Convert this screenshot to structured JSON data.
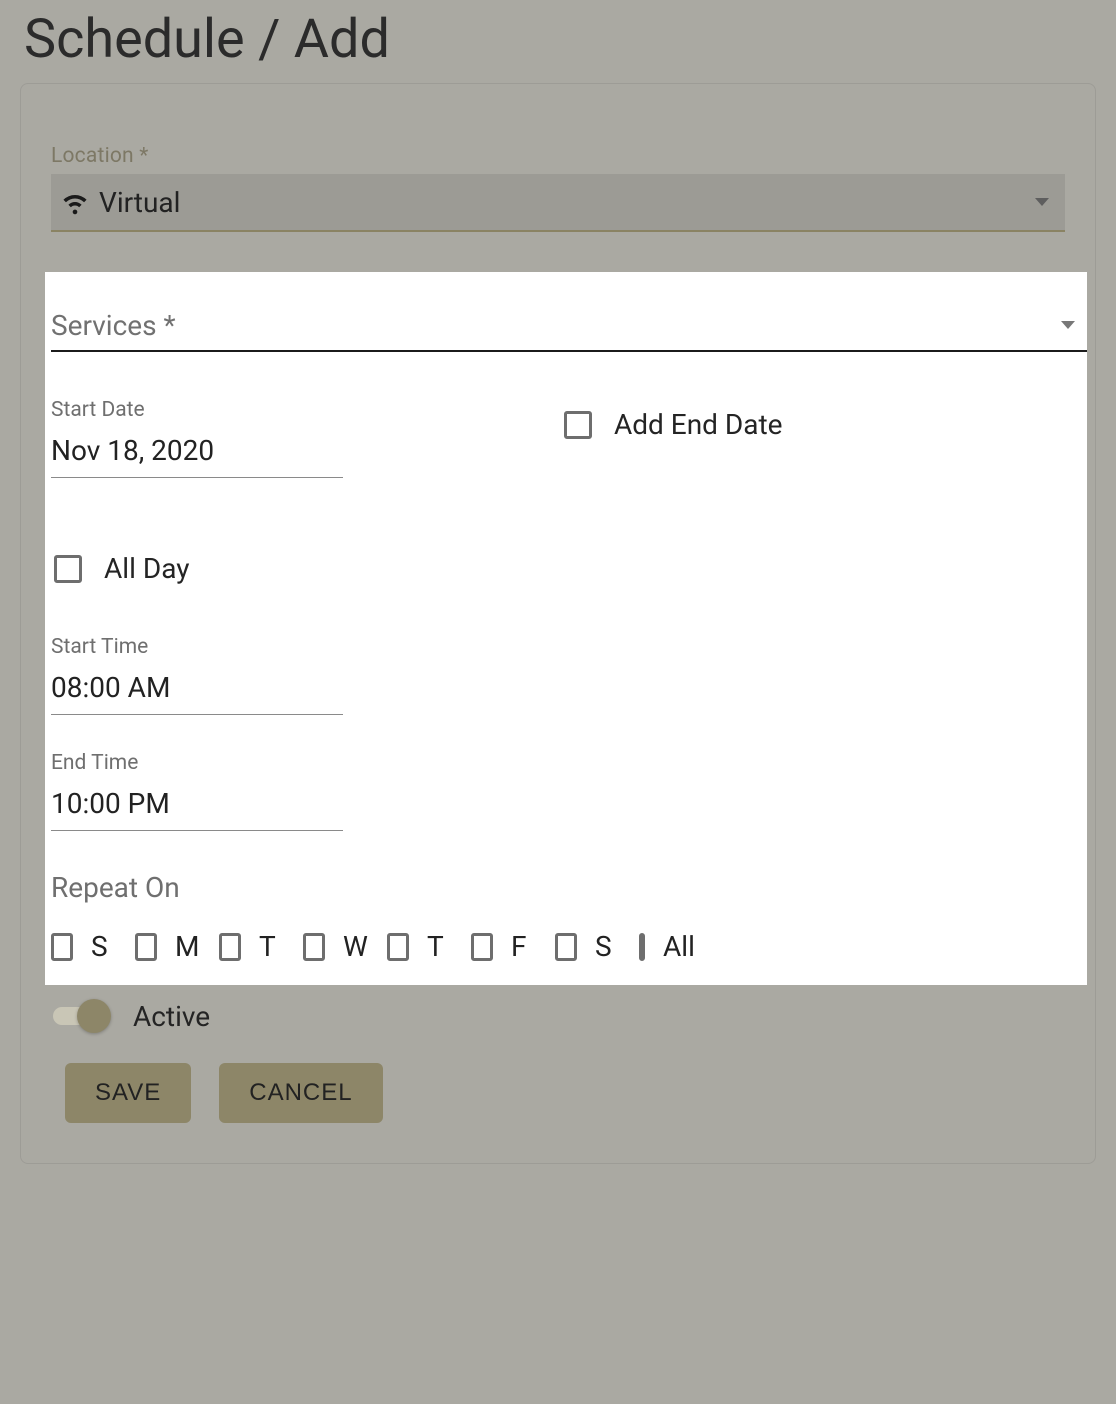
{
  "page_title": "Schedule / Add",
  "location": {
    "label": "Location *",
    "selected": "Virtual"
  },
  "services": {
    "placeholder": "Services *"
  },
  "start_date": {
    "label": "Start Date",
    "value": "Nov 18, 2020"
  },
  "add_end_date": {
    "label": "Add End Date",
    "checked": false
  },
  "all_day": {
    "label": "All Day",
    "checked": false
  },
  "start_time": {
    "label": "Start Time",
    "value": "08:00 AM"
  },
  "end_time": {
    "label": "End Time",
    "value": "10:00 PM"
  },
  "repeat": {
    "label": "Repeat On",
    "days": [
      "S",
      "M",
      "T",
      "W",
      "T",
      "F",
      "S"
    ],
    "all_label": "All"
  },
  "active": {
    "label": "Active",
    "on": true
  },
  "buttons": {
    "save": "SAVE",
    "cancel": "CANCEL"
  }
}
